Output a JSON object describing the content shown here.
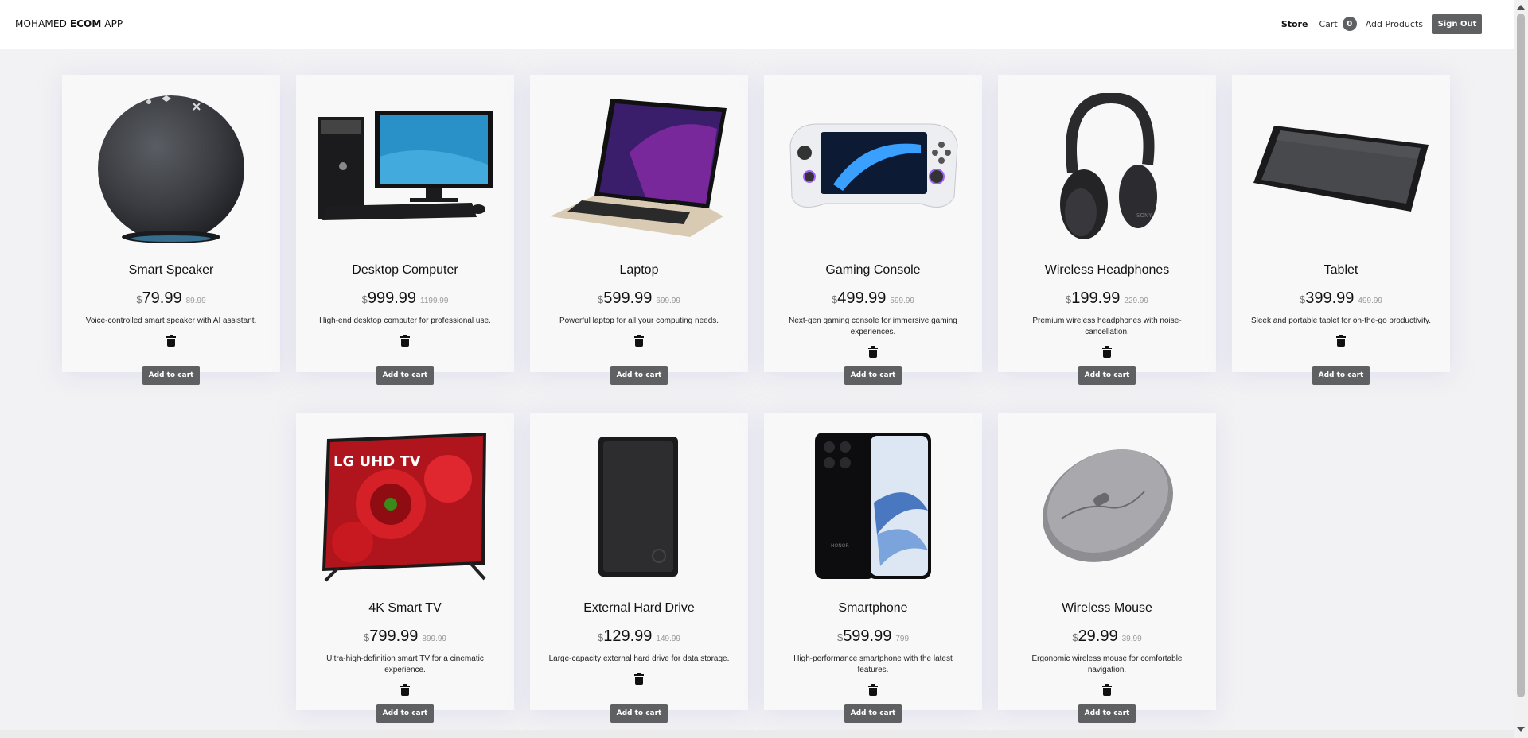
{
  "header": {
    "brand_prefix": "MOHAMED ",
    "brand_bold": "ECOM",
    "brand_suffix": " APP",
    "nav": {
      "store": "Store",
      "cart": "Cart",
      "cart_count": "0",
      "add_products": "Add Products",
      "sign_out": "Sign Out"
    }
  },
  "currency_symbol": "$",
  "add_to_cart_label": "Add to cart",
  "products": [
    {
      "name": "Smart Speaker",
      "price": "79.99",
      "old_price": "89.99",
      "description": "Voice-controlled smart speaker with AI assistant.",
      "image_icon": "smart-speaker-image"
    },
    {
      "name": "Desktop Computer",
      "price": "999.99",
      "old_price": "1199.99",
      "description": "High-end desktop computer for professional use.",
      "image_icon": "desktop-computer-image"
    },
    {
      "name": "Laptop",
      "price": "599.99",
      "old_price": "699.99",
      "description": "Powerful laptop for all your computing needs.",
      "image_icon": "laptop-image"
    },
    {
      "name": "Gaming Console",
      "price": "499.99",
      "old_price": "599.99",
      "description": "Next-gen gaming console for immersive gaming experiences.",
      "image_icon": "gaming-console-image"
    },
    {
      "name": "Wireless Headphones",
      "price": "199.99",
      "old_price": "229.99",
      "description": "Premium wireless headphones with noise-cancellation.",
      "image_icon": "headphones-image"
    },
    {
      "name": "Tablet",
      "price": "399.99",
      "old_price": "499.99",
      "description": "Sleek and portable tablet for on-the-go productivity.",
      "image_icon": "tablet-image"
    },
    {
      "name": "4K Smart TV",
      "price": "799.99",
      "old_price": "899.99",
      "description": "Ultra-high-definition smart TV for a cinematic experience.",
      "image_icon": "smart-tv-image",
      "tv_label": "LG UHD TV"
    },
    {
      "name": "External Hard Drive",
      "price": "129.99",
      "old_price": "149.99",
      "description": "Large-capacity external hard drive for data storage.",
      "image_icon": "hard-drive-image"
    },
    {
      "name": "Smartphone",
      "price": "599.99",
      "old_price": "799",
      "description": "High-performance smartphone with the latest features.",
      "image_icon": "smartphone-image",
      "phone_brand": "HONOR"
    },
    {
      "name": "Wireless Mouse",
      "price": "29.99",
      "old_price": "39.99",
      "description": "Ergonomic wireless mouse for comfortable navigation.",
      "image_icon": "mouse-image"
    }
  ],
  "colors": {
    "button": "#5f6062",
    "page_background": "#f2f2f4",
    "card_background": "#f8f8f9"
  }
}
